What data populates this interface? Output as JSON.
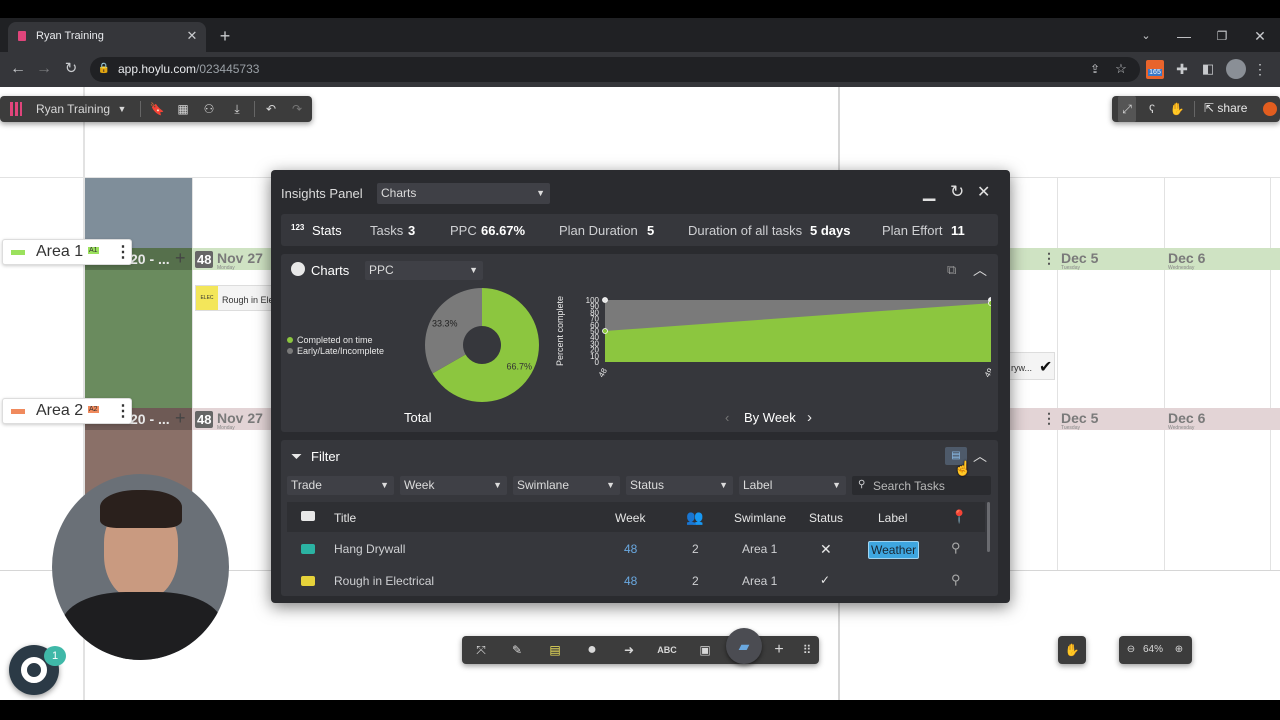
{
  "browser": {
    "tab_title": "Ryan Training",
    "url_host": "app.hoylu.com",
    "url_path": "/023445733",
    "ext_badge": "165"
  },
  "app_toolbar": {
    "workspace_name": "Ryan Training",
    "share_label": "share"
  },
  "board": {
    "areas": [
      {
        "name": "Area 1",
        "tag": "A1",
        "color": "#9be15d"
      },
      {
        "name": "Area 2",
        "tag": "A2",
        "color": "#f08a5d"
      }
    ],
    "row1": {
      "week_label": "20 - ...",
      "week_num": "48",
      "day1": "Nov 27",
      "day2": "Dec 5",
      "day3": "Dec 6",
      "sub1": "Monday",
      "sub2": "Tuesday",
      "sub3": "Wednesday"
    },
    "row2": {
      "week_label": "20 - ...",
      "week_num": "48",
      "day1": "Nov 27",
      "day2": "Dec 5",
      "day3": "Dec 6",
      "sub1": "Monday",
      "sub2": "Tuesday",
      "sub3": "Wednesday"
    },
    "task_card": {
      "trade_tag": "ELEC",
      "title": "Rough in Ele"
    },
    "right_card": {
      "title": "ryw..."
    },
    "zoom": "64%",
    "help_badge": "1",
    "colors": {
      "green_band": "#cfe3c3",
      "pink_band": "#e3d4d6",
      "left_col_green": "#6a8b5e",
      "left_col_slate": "#7f8e9a"
    }
  },
  "insights": {
    "title": "Insights Panel",
    "view_select": "Charts",
    "stats": {
      "label": "Stats",
      "tasks_label": "Tasks",
      "tasks_value": "3",
      "ppc_label": "PPC",
      "ppc_value": "66.67%",
      "plan_duration_label": "Plan Duration",
      "plan_duration_value": "5",
      "duration_all_label": "Duration of all tasks",
      "duration_all_value": "5 days",
      "plan_effort_label": "Plan Effort",
      "plan_effort_value": "11"
    },
    "charts": {
      "label": "Charts",
      "metric_select": "PPC",
      "donut_caption": "Total",
      "week_nav_label": "By Week"
    },
    "filter": {
      "label": "Filter",
      "dropdowns": [
        "Trade",
        "Week",
        "Swimlane",
        "Status",
        "Label"
      ],
      "search_placeholder": "Search Tasks",
      "columns": {
        "title": "Title",
        "week": "Week",
        "swimlane": "Swimlane",
        "status": "Status",
        "label": "Label"
      },
      "rows": [
        {
          "title": "Hang Drywall",
          "week": "48",
          "crew": "2",
          "swimlane": "Area 1",
          "status": "✕",
          "label": "Weather",
          "trade_color": "#2bb3a3"
        },
        {
          "title": "Rough in Electrical",
          "week": "48",
          "crew": "2",
          "swimlane": "Area 1",
          "status": "✓",
          "label": "",
          "trade_color": "#e6d23a"
        }
      ]
    }
  },
  "chart_data": [
    {
      "type": "pie",
      "title": "Total",
      "categories": [
        "Completed on time",
        "Early/Late/Incomplete"
      ],
      "values": [
        66.7,
        33.3
      ],
      "colors": [
        "#8cc63f",
        "#7a7a7a"
      ],
      "legend": "left"
    },
    {
      "type": "area",
      "title": "By Week",
      "xlabel": "",
      "ylabel": "Percent complete",
      "x": [
        "48",
        "49"
      ],
      "series": [
        {
          "name": "Completed on time",
          "values": [
            50,
            95
          ],
          "color": "#8cc63f"
        },
        {
          "name": "Early/Late/Incomplete",
          "values": [
            100,
            100
          ],
          "color": "#7a7a7a"
        }
      ],
      "ylim": [
        0,
        100
      ],
      "yticks": [
        "100",
        "90",
        "80",
        "70",
        "60",
        "50",
        "40",
        "30",
        "20",
        "10",
        "0"
      ]
    }
  ]
}
